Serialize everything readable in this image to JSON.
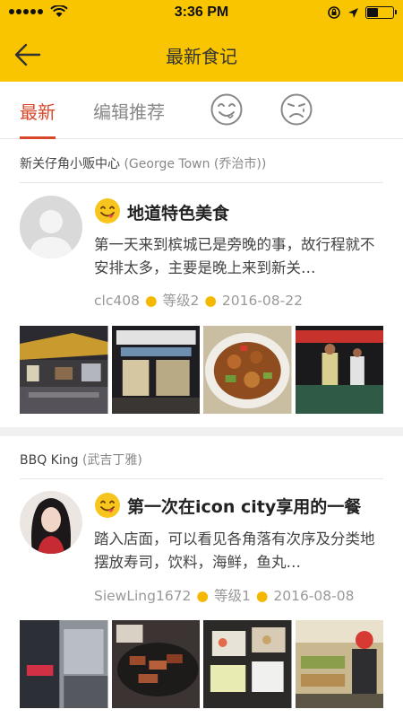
{
  "status_bar": {
    "time": "3:36 PM"
  },
  "nav": {
    "title": "最新食记"
  },
  "tabs": [
    {
      "label": "最新",
      "active": true
    },
    {
      "label": "编辑推荐",
      "active": false
    },
    {
      "icon": "yummy-face-icon"
    },
    {
      "icon": "unhappy-face-icon"
    }
  ],
  "posts": [
    {
      "place_name": "新关仔角小贩中心",
      "place_local": "(George Town (乔治市))",
      "title": "地道特色美食",
      "excerpt": "第一天来到槟城已是旁晚的事，故行程就不安排太多，主要是晚上来到新关…",
      "author": "clc408",
      "level": "等级2",
      "date": "2016-08-22",
      "avatar": "default-avatar",
      "photos": [
        "night-hawker-stalls",
        "food-stall-counter",
        "stir-fried-dish",
        "hawker-cooks"
      ]
    },
    {
      "place_name": "BBQ King",
      "place_local": "(武吉丁雅)",
      "title": "第一次在icon city享用的一餐",
      "excerpt": "踏入店面，可以看见各角落有次序及分类地摆放寿司，饮料，海鲜，鱼丸…",
      "author": "SiewLing1672",
      "level": "等级1",
      "date": "2016-08-08",
      "avatar": "user-photo",
      "photos": [
        "bbq-king-storefront",
        "grill-pan-meat",
        "sushi-trays",
        "buffet-counter"
      ]
    }
  ],
  "colors": {
    "brand_yellow": "#f9c400",
    "active_tab": "#d9472b",
    "meta_dot": "#f5b800"
  }
}
